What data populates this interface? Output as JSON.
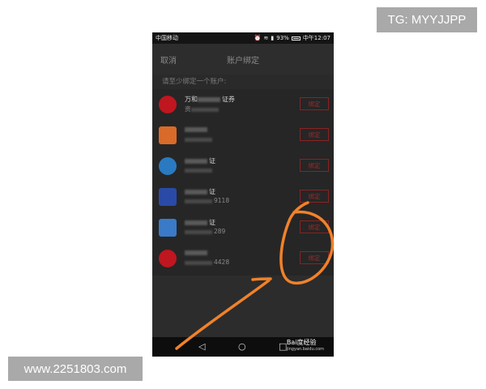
{
  "watermarks": {
    "top_right": "TG: MYYJJPP",
    "bottom_left": "www.2251803.com"
  },
  "statusbar": {
    "carrier": "中国移动",
    "battery_percent": "93%",
    "time": "中午12:07"
  },
  "topbar": {
    "cancel_label": "取消",
    "title": "账户绑定"
  },
  "hint": "请至少绑定一个账户:",
  "accounts": [
    {
      "name_visible": "万和",
      "name_suffix": "证券",
      "account_visible": "资",
      "account_suffix": "",
      "bind_label": "绑定",
      "logo_color": "#c0161f",
      "logo_shape": "circle"
    },
    {
      "name_visible": "",
      "name_suffix": "",
      "account_visible": "",
      "account_suffix": "",
      "bind_label": "绑定",
      "logo_color": "#d96a2a",
      "logo_shape": "square"
    },
    {
      "name_visible": "",
      "name_suffix": "证",
      "account_visible": "",
      "account_suffix": "",
      "bind_label": "绑定",
      "logo_color": "#2a7ac2",
      "logo_shape": "circle"
    },
    {
      "name_visible": "",
      "name_suffix": "证",
      "account_visible": "",
      "account_suffix": "9118",
      "bind_label": "绑定",
      "logo_color": "#2a4aa8",
      "logo_shape": "square"
    },
    {
      "name_visible": "",
      "name_suffix": "证",
      "account_visible": "",
      "account_suffix": "289",
      "bind_label": "绑定",
      "logo_color": "#3a7ac8",
      "logo_shape": "square"
    },
    {
      "name_visible": "",
      "name_suffix": "",
      "account_visible": "",
      "account_suffix": "4428",
      "bind_label": "绑定",
      "logo_color": "#c0161f",
      "logo_shape": "circle"
    }
  ],
  "navbar": {
    "back_icon": "triangle-back-icon",
    "home_icon": "circle-home-icon",
    "recent_icon": "square-recent-icon",
    "baidu_logo": "Bai度经验",
    "baidu_url": "jingyan.baidu.com"
  },
  "annotation_color": "#f0822a"
}
